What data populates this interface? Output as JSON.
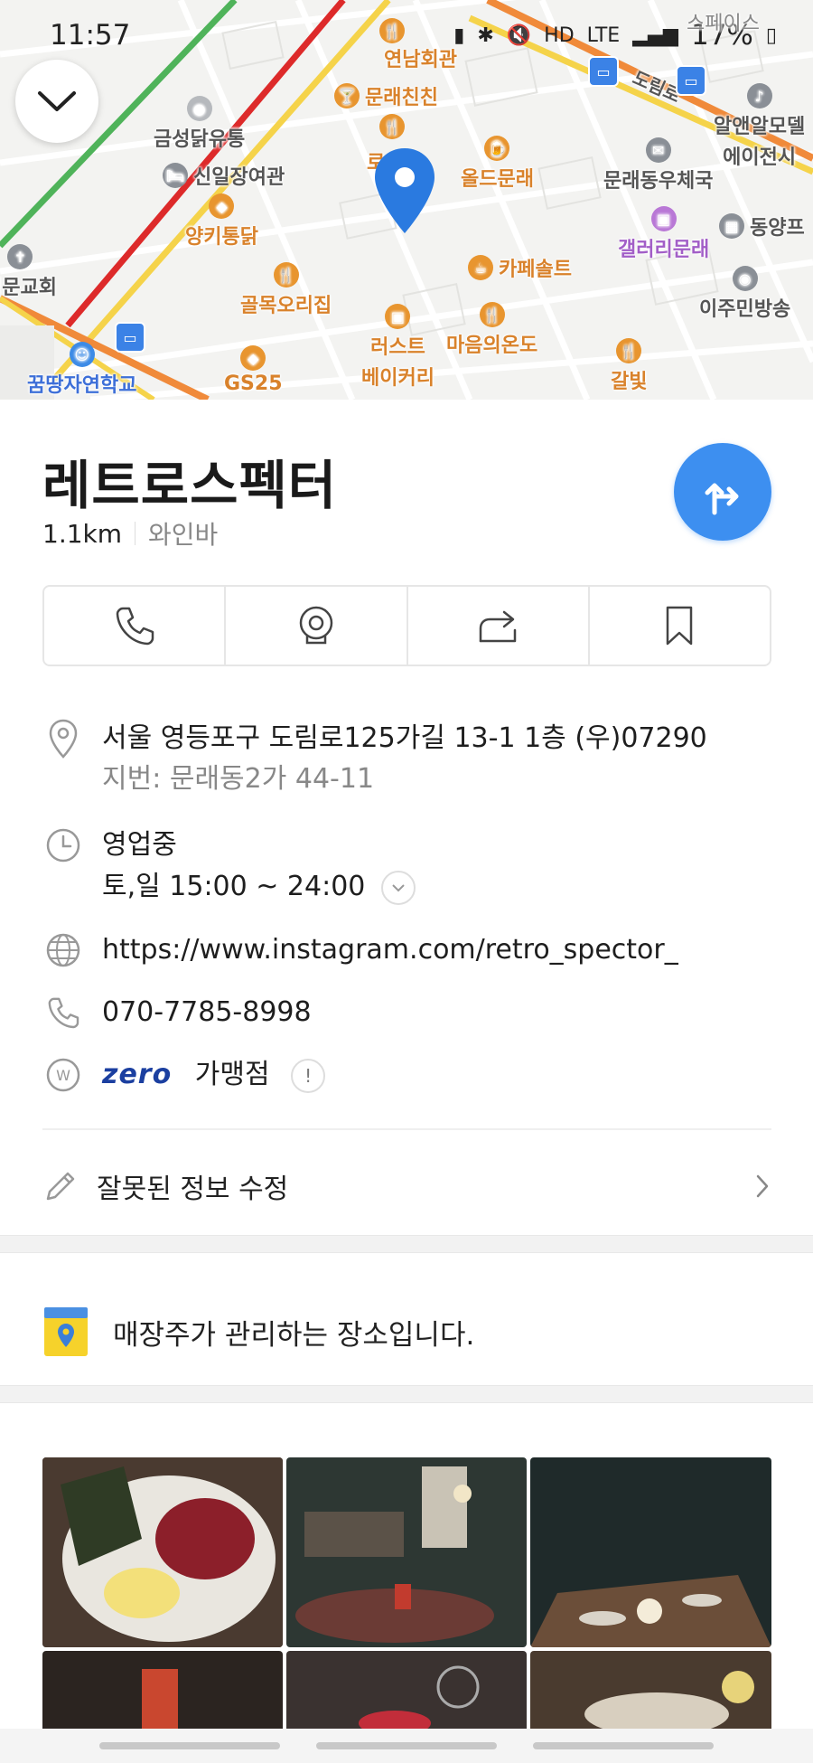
{
  "status_bar": {
    "time": "11:57",
    "network": "LTE",
    "hd_voice": "HD",
    "battery": "17%"
  },
  "map": {
    "labels": {
      "yeonnam": "연남회관",
      "munraechinchin": "문래친친",
      "geumseong": "금성닭유통",
      "sinil": "신일장여관",
      "yangki": "양키통닭",
      "ro": "로",
      "old": "올드문래",
      "munrae_post": "문래동우체국",
      "alaeal": "알앤알모델",
      "alaeal2": "에이전시",
      "dongyang": "동양프",
      "gallery": "갤러리문래",
      "cafe_salt": "카페솔트",
      "golmok": "골목오리집",
      "rust1": "러스트",
      "rust2": "베이커리",
      "maeum": "마음의온도",
      "galbit": "갈빛",
      "leejumin": "이주민방송",
      "church": "영문교회",
      "kkumttang": "꿈땅자연학교",
      "gs25": "GS25",
      "road": "도림로",
      "space": "스페이스"
    }
  },
  "place": {
    "name": "레트로스펙터",
    "distance": "1.1km",
    "category": "와인바",
    "address": "서울 영등포구 도림로125가길 13-1 1층 (우)07290",
    "jibun": "지번: 문래동2가 44-11",
    "open_status": "영업중",
    "hours": "토,일 15:00 ~ 24:00",
    "website": "https://www.instagram.com/retro_spector_",
    "phone": "070-7785-8998",
    "zeropay_brand": "zero",
    "zeropay_label": "가맹점",
    "edit_label": "잘못된 정보 수정",
    "owner_label": "매장주가 관리하는 장소입니다."
  },
  "colors": {
    "accent_blue": "#3d8ff0",
    "open_green": "#2e9e6a",
    "link_blue": "#2b7fd6",
    "poi_orange": "#e8952f"
  }
}
